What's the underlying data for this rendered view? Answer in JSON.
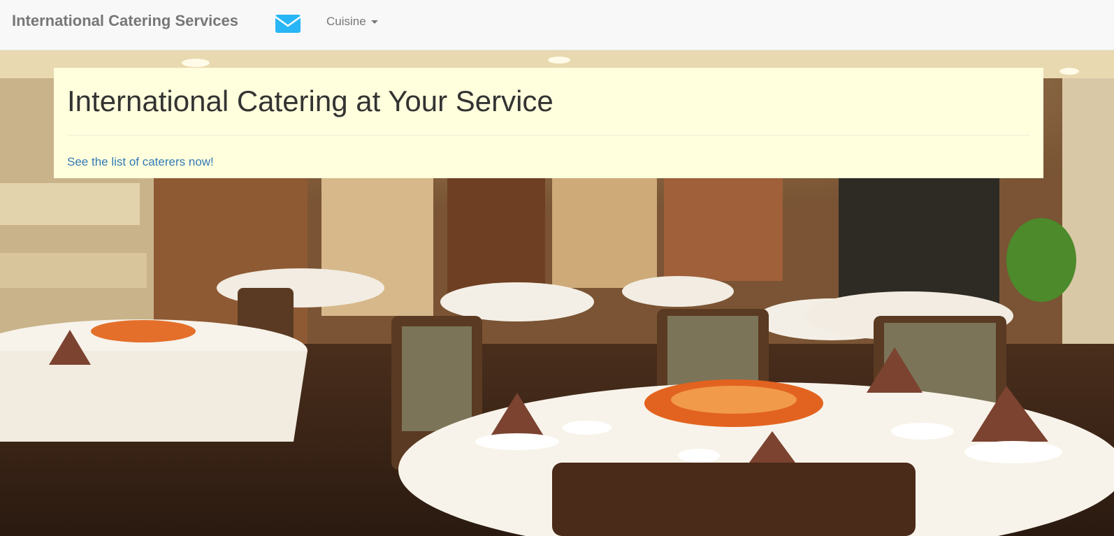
{
  "navbar": {
    "brand": "International Catering Services",
    "mail_icon": "envelope-icon",
    "mail_color": "#29b6f6",
    "cuisine_label": "Cuisine",
    "cuisine_icon": "caret-down-icon"
  },
  "hero": {
    "image": "restaurant-dining-room-photo"
  },
  "jumbotron": {
    "background": "#ffffdd",
    "title": "International Catering at Your Service",
    "link_text": "See the list of caterers now!",
    "link_color": "#337ab7"
  }
}
